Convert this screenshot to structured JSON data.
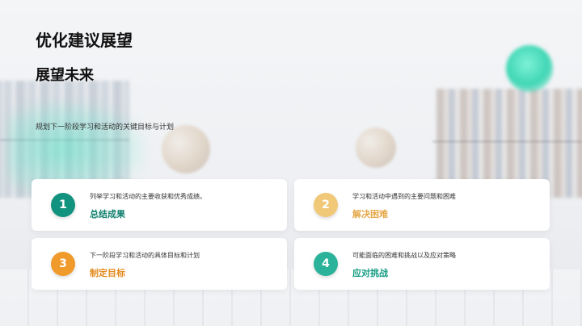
{
  "slide": {
    "title": "优化建议展望",
    "subtitle": "展望未来",
    "intro": "规划下一阶段学习和活动的关键目标与计划"
  },
  "cards": [
    {
      "number": "1",
      "description": "列举学习和活动的主要收获和优秀成绩。",
      "heading": "总结成果",
      "badge_color": "#12937f",
      "heading_color": "#0f7f6d"
    },
    {
      "number": "2",
      "description": "学习和活动中遇到的主要问题和困难",
      "heading": "解决困难",
      "badge_color": "#f0c878",
      "heading_color": "#e5a94a"
    },
    {
      "number": "3",
      "description": "下一阶段学习和活动的具体目标和计划",
      "heading": "制定目标",
      "badge_color": "#ef9a2a",
      "heading_color": "#e28a1c"
    },
    {
      "number": "4",
      "description": "可能面临的困难和挑战以及应对策略",
      "heading": "应对挑战",
      "badge_color": "#2ab39a",
      "heading_color": "#169c84"
    }
  ],
  "icons": {
    "orb": "teal-orb-decoration"
  }
}
